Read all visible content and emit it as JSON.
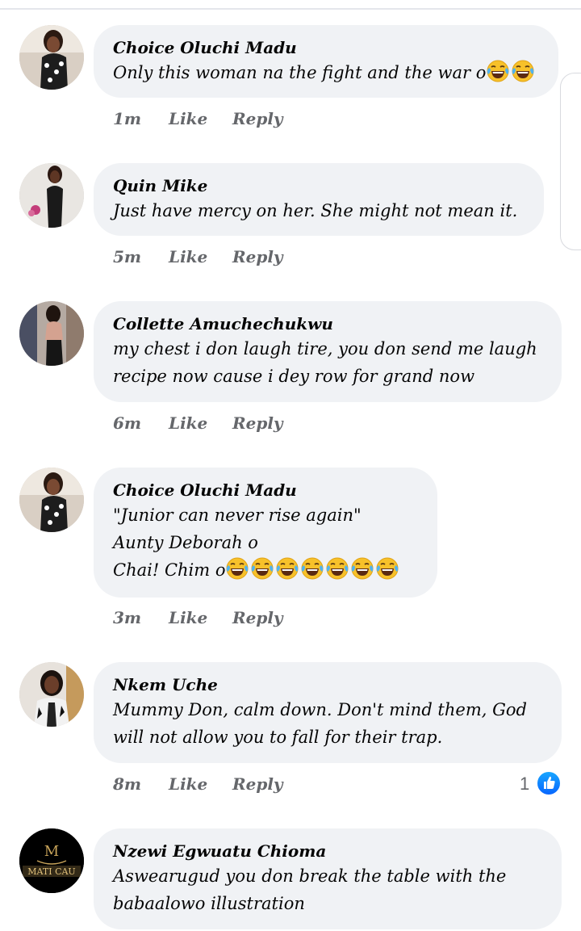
{
  "comments": [
    {
      "name": "Choice Oluchi Madu",
      "lines": [
        "Only this woman na the fight and the war o"
      ],
      "emoji_count": 2,
      "time": "1m",
      "like": "Like",
      "reply": "Reply"
    },
    {
      "name": "Quin Mike",
      "lines": [
        "Just have mercy on her. She might not mean it."
      ],
      "emoji_count": 0,
      "time": "5m",
      "like": "Like",
      "reply": "Reply"
    },
    {
      "name": "Collette Amuchechukwu",
      "lines": [
        " my chest i don laugh tire, you don send me laugh",
        "recipe now cause i dey row for grand now"
      ],
      "emoji_count": 0,
      "time": "6m",
      "like": "Like",
      "reply": "Reply"
    },
    {
      "name": "Choice Oluchi Madu",
      "lines": [
        "\"Junior can never rise again\"",
        "Aunty Deborah o",
        "Chai! Chim o"
      ],
      "emoji_count": 7,
      "time": "3m",
      "like": "Like",
      "reply": "Reply"
    },
    {
      "name": "Nkem Uche",
      "lines": [
        "Mummy Don, calm down. Don't mind them, God",
        "will not allow you to fall for their trap."
      ],
      "emoji_count": 0,
      "time": "8m",
      "like": "Like",
      "reply": "Reply",
      "reaction_count": "1"
    },
    {
      "name": "Nzewi Egwuatu Chioma",
      "lines": [
        "Aswearugud you don break the table with the",
        "babaalowo illustration"
      ],
      "emoji_count": 0,
      "avatar_logo_text": "MATI CAU"
    }
  ],
  "icons": {
    "emoji": "laughing-tears-emoji-icon",
    "reaction": "thumbs-up-like-icon"
  },
  "colors": {
    "bubble": "#f0f2f5",
    "meta": "#65676b",
    "like_blue": "#0866ff"
  }
}
